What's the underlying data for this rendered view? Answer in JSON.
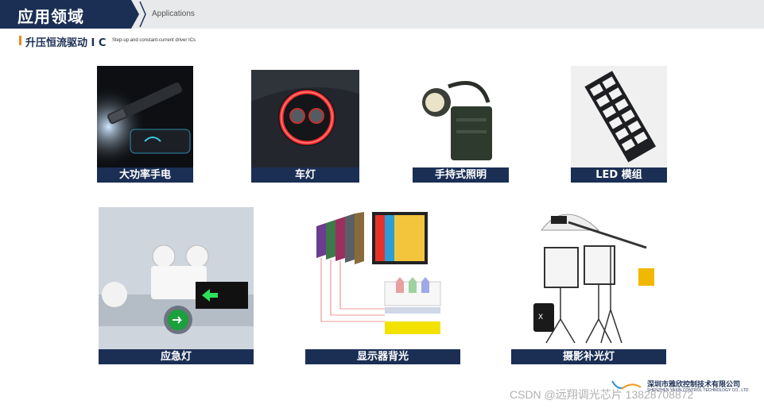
{
  "header": {
    "title": "应用领域",
    "subtitle": "Applications"
  },
  "section": {
    "title": "升压恒流驱动 I C",
    "subtitle": "Step-up and constant-current driver ICs"
  },
  "cards": [
    {
      "label": "大功率手电",
      "icon": "flashlight-image"
    },
    {
      "label": "车灯",
      "icon": "car-headlight-image"
    },
    {
      "label": "手持式照明",
      "icon": "handheld-lamp-image"
    },
    {
      "label": "LED 模组",
      "icon": "led-module-image"
    },
    {
      "label": "应急灯",
      "icon": "emergency-light-image"
    },
    {
      "label": "显示器背光",
      "icon": "display-backlight-image"
    },
    {
      "label": "摄影补光灯",
      "icon": "photo-fill-light-image"
    }
  ],
  "footer": {
    "company_cn": "深圳市雅欣控制技术有限公司",
    "company_en": "SHENZHEN YAXIN CONTROL TECHNOLOGY CO., LTD",
    "watermark": "CSDN @远翔调光芯片 13828708872"
  }
}
